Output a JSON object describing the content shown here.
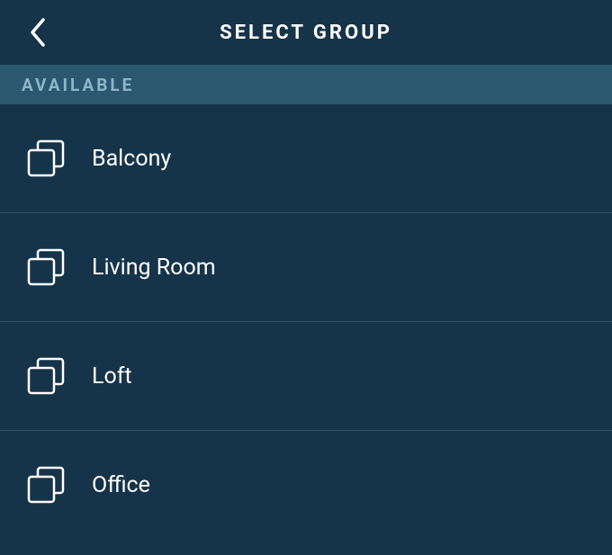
{
  "header": {
    "title": "SELECT GROUP"
  },
  "section": {
    "label": "AVAILABLE"
  },
  "groups": [
    {
      "label": "Balcony"
    },
    {
      "label": "Living Room"
    },
    {
      "label": "Loft"
    },
    {
      "label": "Office"
    }
  ]
}
